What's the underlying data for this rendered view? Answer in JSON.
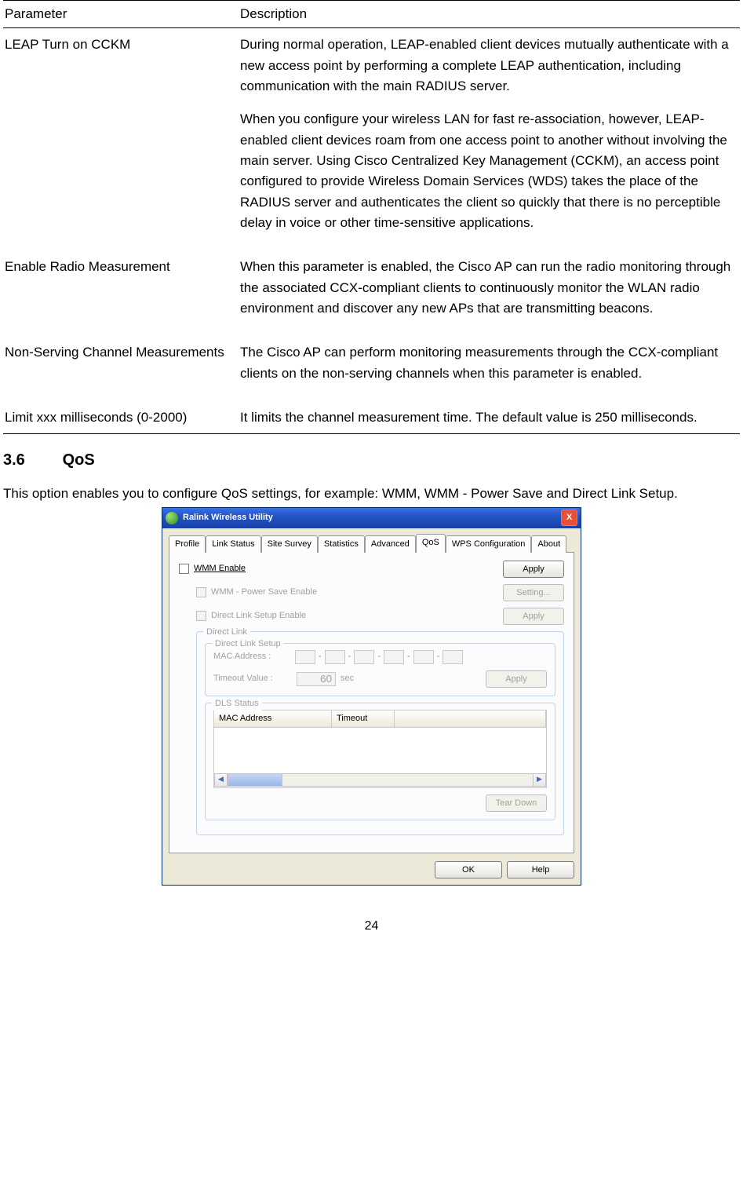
{
  "table": {
    "head_param": "Parameter",
    "head_desc": "Description",
    "rows": [
      {
        "param": "LEAP Turn on CCKM",
        "desc1": "During normal operation, LEAP-enabled client devices mutually authenticate with a new access point by performing a complete LEAP authentication, including communication with the main RADIUS server.",
        "desc2": "When you configure your wireless LAN for fast re-association, however, LEAP-enabled client devices roam from one access point to another without involving the main server. Using Cisco Centralized Key Management (CCKM), an access point configured to provide Wireless Domain Services (WDS) takes the place of the RADIUS server and authenticates the client so quickly that there is no perceptible delay in voice or other time-sensitive applications."
      },
      {
        "param": "Enable Radio Measurement",
        "desc1": "When this parameter is enabled, the Cisco AP can run the radio monitoring through the associated CCX-compliant clients to continuously monitor the WLAN radio environment and discover any new APs that are transmitting beacons."
      },
      {
        "param": "Non-Serving Channel Measurements",
        "desc1": "The Cisco AP can perform monitoring measurements through the CCX-compliant clients on the non-serving channels when this parameter is enabled."
      },
      {
        "param": "Limit xxx milliseconds (0-2000)",
        "desc1": "It limits the channel measurement time. The default value is 250 milliseconds."
      }
    ]
  },
  "section": {
    "num": "3.6",
    "title": "QoS"
  },
  "intro": "This option enables you to configure QoS settings, for example: WMM, WMM - Power Save and Direct Link Setup.",
  "win": {
    "title": "Ralink Wireless Utility",
    "tabs": [
      "Profile",
      "Link Status",
      "Site Survey",
      "Statistics",
      "Advanced",
      "QoS",
      "WPS Configuration",
      "About"
    ],
    "selected_tab": "QoS",
    "wmm_enable": "WMM Enable",
    "wmm_ps": "WMM - Power Save Enable",
    "dls_enable": "Direct Link Setup Enable",
    "btn_apply": "Apply",
    "btn_setting": "Setting...",
    "group_direct": "Direct Link",
    "group_setup": "Direct Link Setup",
    "mac_label": "MAC Address :",
    "timeout_label": "Timeout Value :",
    "timeout_val": "60",
    "timeout_unit": "sec",
    "group_dls": "DLS Status",
    "col_mac": "MAC Address",
    "col_timeout": "Timeout",
    "btn_tear": "Tear Down",
    "btn_ok": "OK",
    "btn_help": "Help",
    "close": "X"
  },
  "page_number": "24"
}
